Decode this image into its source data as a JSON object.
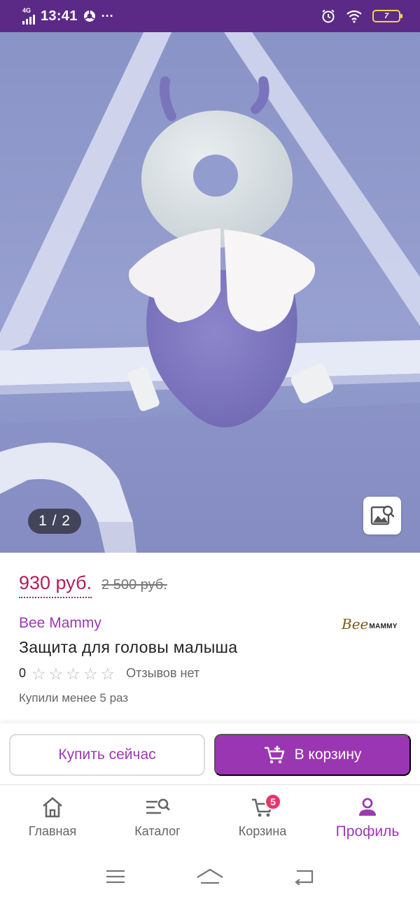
{
  "status_bar": {
    "network": "4G",
    "time": "13:41",
    "more": "···",
    "battery_level": "7"
  },
  "gallery": {
    "counter": "1 / 2"
  },
  "product": {
    "price": "930 руб.",
    "old_price": "2 500 руб.",
    "brand": "Bee Mammy",
    "brand_logo_text": "Bee",
    "brand_logo_sub": "MAMMY",
    "title": "Защита для головы малыша",
    "rating_value": "0",
    "rating_stars_filled": 0,
    "rating_stars_total": 5,
    "reviews_text": "Отзывов нет",
    "bought_text": "Купили менее 5 раз"
  },
  "actions": {
    "buy_now_label": "Купить сейчас",
    "add_to_cart_label": "В корзину"
  },
  "bottom_nav": {
    "items": [
      {
        "label": "Главная",
        "icon": "home-icon"
      },
      {
        "label": "Каталог",
        "icon": "catalog-search-icon"
      },
      {
        "label": "Корзина",
        "icon": "cart-icon",
        "badge": "5"
      },
      {
        "label": "Профиль",
        "icon": "profile-icon",
        "active": true
      }
    ]
  },
  "colors": {
    "status_bar": "#5b2a86",
    "accent": "#9a36b2",
    "price": "#b01e5a",
    "badge": "#e8356a"
  }
}
